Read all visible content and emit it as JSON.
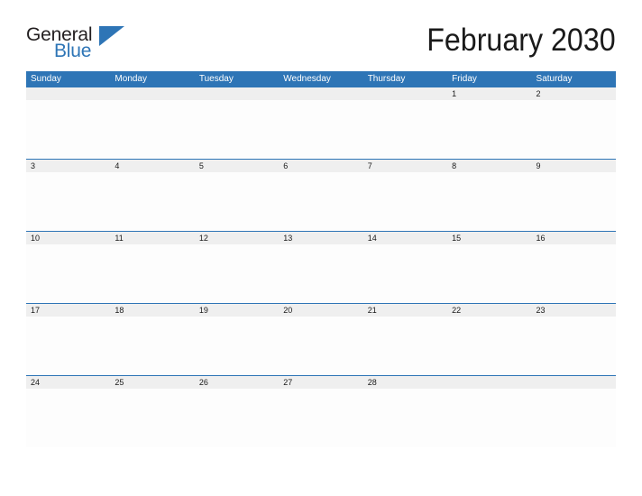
{
  "brand": {
    "line1": "General",
    "line2": "Blue",
    "flag_color": "#2e75b6",
    "text_color": "#231f20"
  },
  "header": {
    "title": "February 2030",
    "month": "February",
    "year": "2030"
  },
  "theme": {
    "header_bar_color": "#2e75b6",
    "date_band_color": "#efefef",
    "week_rule_color": "#2e75b6",
    "page_background": "#ffffff",
    "cell_background": "#fdfdfd"
  },
  "calendar": {
    "weekdays": [
      "Sunday",
      "Monday",
      "Tuesday",
      "Wednesday",
      "Thursday",
      "Friday",
      "Saturday"
    ],
    "weeks": [
      [
        "",
        "",
        "",
        "",
        "",
        "1",
        "2"
      ],
      [
        "3",
        "4",
        "5",
        "6",
        "7",
        "8",
        "9"
      ],
      [
        "10",
        "11",
        "12",
        "13",
        "14",
        "15",
        "16"
      ],
      [
        "17",
        "18",
        "19",
        "20",
        "21",
        "22",
        "23"
      ],
      [
        "24",
        "25",
        "26",
        "27",
        "28",
        "",
        ""
      ]
    ]
  }
}
